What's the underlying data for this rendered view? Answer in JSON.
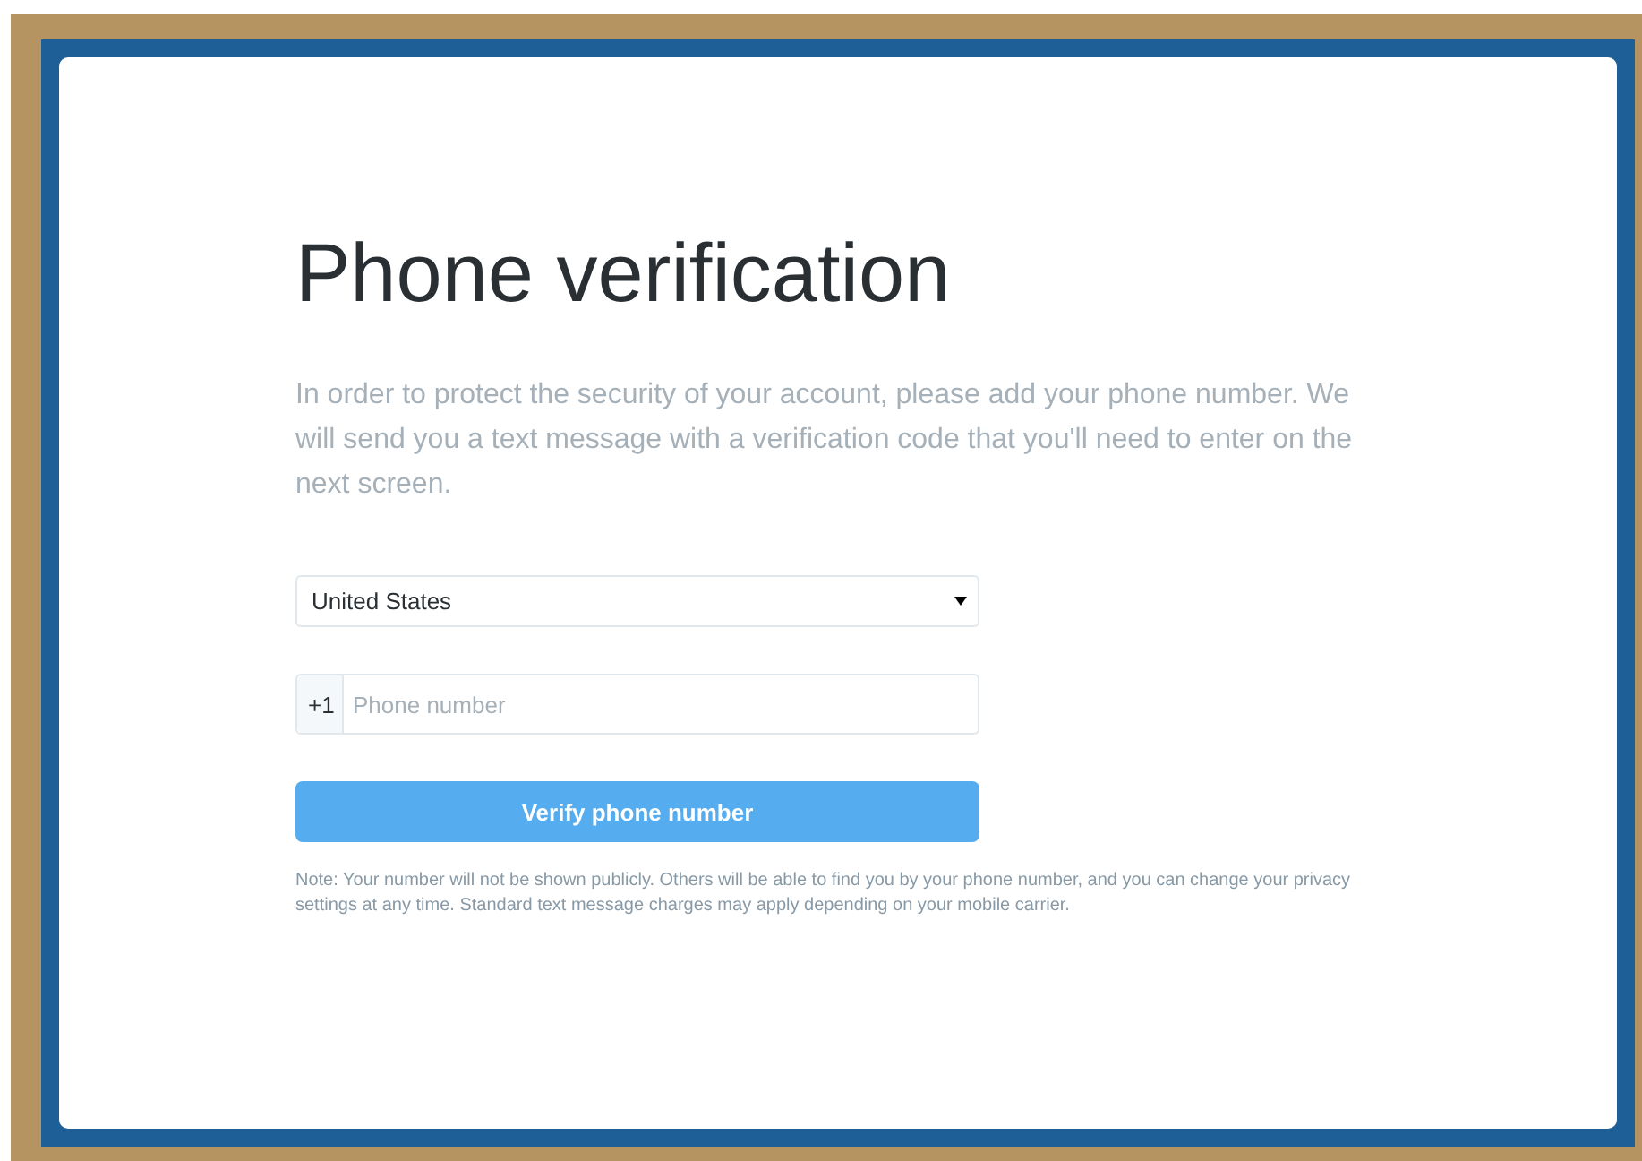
{
  "title": "Phone verification",
  "intro": "In order to protect the security of your account, please add your phone number. We will send you a text message with a verification code that you'll need to enter on the next screen.",
  "country_select": {
    "value": "United States"
  },
  "phone_field": {
    "prefix": "+1",
    "placeholder": "Phone number"
  },
  "submit_button": {
    "label": "Verify phone number"
  },
  "note": "Note: Your number will not be shown publicly. Others will be able to find you by your phone number, and you can change your privacy settings at any time. Standard text message charges may apply depending on your mobile carrier."
}
